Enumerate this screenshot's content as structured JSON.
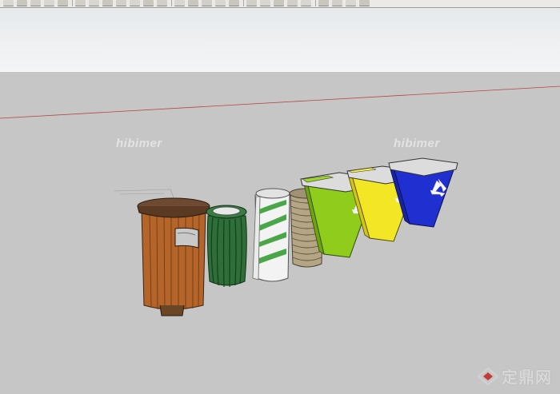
{
  "toolbar": {
    "tools": [
      "orbit-tool",
      "select-tool",
      "eraser-tool",
      "paint-tool",
      "line-tool",
      "rectangle-tool",
      "circle-tool",
      "arc-tool",
      "move-tool",
      "push-pull-tool",
      "rotate-tool",
      "offset-tool",
      "tape-tool",
      "dimension-tool",
      "text-tool",
      "zoom-tool",
      "zoom-window-tool",
      "zoom-extents-tool",
      "previous-view-tool",
      "next-view-tool",
      "iso-view",
      "top-view",
      "front-view",
      "right-view",
      "back-view",
      "left-view"
    ]
  },
  "scene": {
    "objects": [
      {
        "name": "wooden-trash-bin"
      },
      {
        "name": "green-slatted-trash-bin"
      },
      {
        "name": "white-green-striped-bin"
      },
      {
        "name": "stacked-stone-bin"
      },
      {
        "name": "lime-recycling-bin"
      },
      {
        "name": "yellow-recycling-bin"
      },
      {
        "name": "blue-recycling-bin"
      }
    ],
    "colors": {
      "ground": "#c6c6c6",
      "sky": "#eceef0",
      "wood": "#b5652a",
      "green_bin": "#2e6e38",
      "lime": "#8fcc1c",
      "yellow": "#f3e625",
      "blue": "#1f2fd0",
      "horizon_axis": "#b84444"
    }
  },
  "watermark": {
    "left_text": "hibimer",
    "right_text": "hibimer"
  },
  "logo": {
    "text": "定鼎网"
  }
}
